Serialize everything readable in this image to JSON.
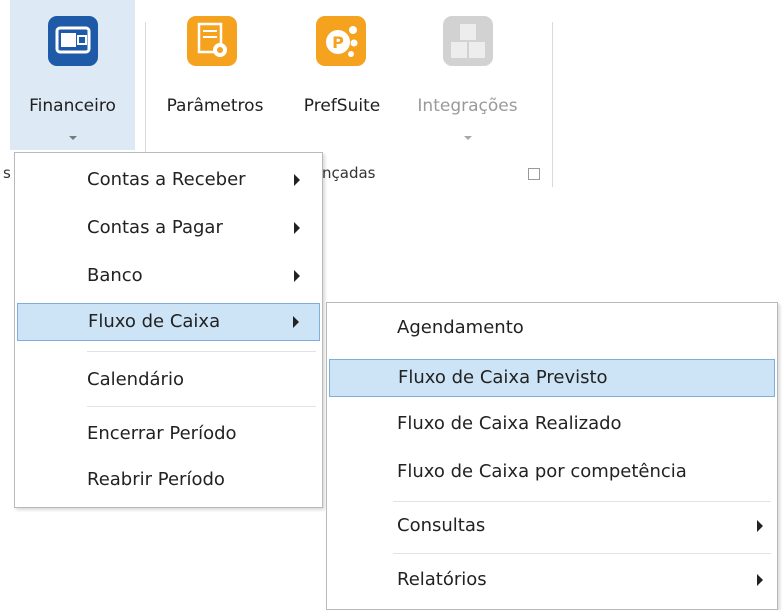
{
  "ribbon": {
    "financeiro": {
      "label": "Financeiro",
      "icon": "wallet-icon",
      "color": "#1e5aa8"
    },
    "parametros": {
      "label": "Parâmetros",
      "icon": "settings-icon",
      "color": "#f5a21e"
    },
    "prefsuite": {
      "label": "PrefSuite",
      "icon": "prefsuite-logo-icon",
      "color": "#f5a21e"
    },
    "integracoes": {
      "label": "Integrações",
      "icon": "cubes-icon",
      "color": "#c9c9c9"
    },
    "group_label": "nçadas",
    "group_left_fragment": "s"
  },
  "menu": {
    "items": [
      {
        "label": "Contas a Receber",
        "has_submenu": true
      },
      {
        "label": "Contas a Pagar",
        "has_submenu": true
      },
      {
        "label": "Banco",
        "has_submenu": true
      },
      {
        "label": "Fluxo de Caixa",
        "has_submenu": true,
        "highlighted": true
      },
      {
        "label": "Calendário",
        "has_submenu": false
      },
      {
        "label": "Encerrar Período",
        "has_submenu": false
      },
      {
        "label": "Reabrir Período",
        "has_submenu": false
      }
    ]
  },
  "submenu": {
    "items": [
      {
        "label": "Agendamento",
        "has_submenu": false
      },
      {
        "label": "Fluxo de Caixa Previsto",
        "has_submenu": false,
        "highlighted": true
      },
      {
        "label": "Fluxo de Caixa Realizado",
        "has_submenu": false
      },
      {
        "label": "Fluxo de Caixa por competência",
        "has_submenu": false
      },
      {
        "label": "Consultas",
        "has_submenu": true
      },
      {
        "label": "Relatórios",
        "has_submenu": true
      }
    ]
  },
  "colors": {
    "highlight_bg": "#cde4f7",
    "highlight_border": "#7daee0",
    "selected_tab_bg": "#dde9f5"
  }
}
